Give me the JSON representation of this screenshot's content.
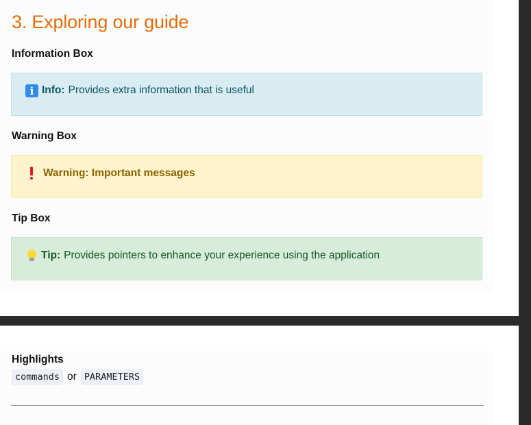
{
  "section": {
    "title": "3. Exploring our guide"
  },
  "info_box": {
    "heading": "Information Box",
    "icon": "info-icon",
    "label": "Info:",
    "text": "Provides extra information that is useful"
  },
  "warning_box": {
    "heading": "Warning Box",
    "icon": "exclamation-icon",
    "text": "Warning: Important messages"
  },
  "tip_box": {
    "heading": "Tip Box",
    "icon": "lightbulb-icon",
    "label": "Tip:",
    "text": "Provides pointers to enhance your experience using the application"
  },
  "highlights": {
    "heading": "Highlights",
    "code_1": "commands",
    "connector": "or",
    "code_2": "PARAMETERS"
  },
  "colors": {
    "title_orange": "#e46c0a",
    "info_bg": "#d8ecf2",
    "warning_bg": "#fff3cd",
    "tip_bg": "#d7ecdb"
  }
}
